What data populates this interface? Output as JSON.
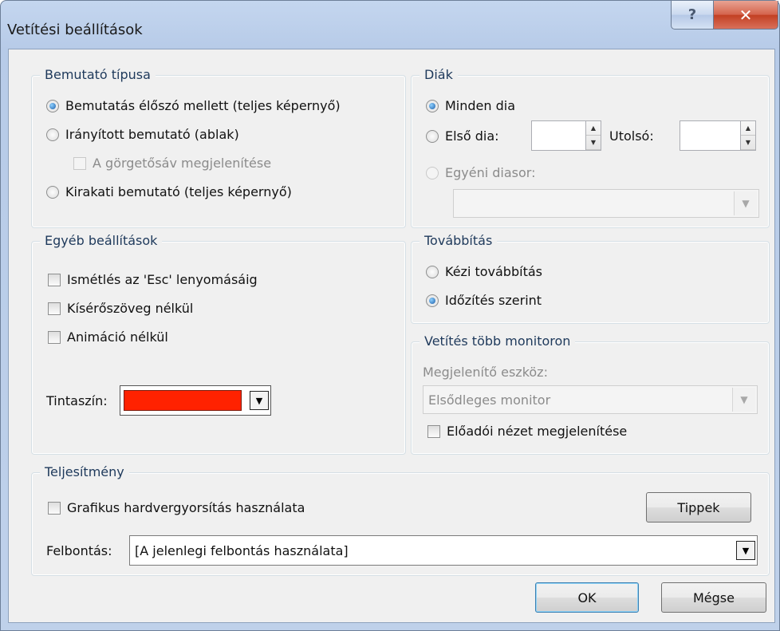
{
  "window": {
    "title": "Vetítési beállítások",
    "help_glyph": "?",
    "close_glyph": "✕"
  },
  "show_type": {
    "legend": "Bemutató típusa",
    "options": [
      {
        "label": "Bemutatás élőszó mellett (teljes képernyő)",
        "checked": true
      },
      {
        "label": "Irányított bemutató (ablak)",
        "checked": false
      },
      {
        "label": "Kirakati bemutató (teljes képernyő)",
        "checked": false
      }
    ],
    "scrollbar_label": "A görgetősáv megjelenítése"
  },
  "slides": {
    "legend": "Diák",
    "all_label": "Minden dia",
    "from_label": "Első dia:",
    "to_label": "Utolsó:",
    "from_value": "",
    "to_value": "",
    "custom_label": "Egyéni diasor:",
    "custom_value": ""
  },
  "other": {
    "legend": "Egyéb beállítások",
    "loop_label": "Ismétlés az 'Esc' lenyomásáig",
    "no_narration_label": "Kísérőszöveg nélkül",
    "no_animation_label": "Animáció nélkül",
    "pen_color_label": "Tintaszín:",
    "pen_color": "#ff2200"
  },
  "advance": {
    "legend": "Továbbítás",
    "manual_label": "Kézi továbbítás",
    "timings_label": "Időzítés szerint"
  },
  "monitors": {
    "legend": "Vetítés több monitoron",
    "display_label": "Megjelenítő eszköz:",
    "display_value": "Elsődleges monitor",
    "presenter_view_label": "Előadói nézet megjelenítése"
  },
  "performance": {
    "legend": "Teljesítmény",
    "hw_accel_label": "Grafikus hardvergyorsítás használata",
    "tips_button": "Tippek",
    "resolution_label": "Felbontás:",
    "resolution_value": "[A jelenlegi felbontás használata]"
  },
  "footer": {
    "ok": "OK",
    "cancel": "Mégse"
  },
  "colors": {
    "title_bar": "#b7cbe8",
    "client_bg": "#f0f0f0",
    "legend_text": "#1e395b",
    "close_button": "#c23f22"
  }
}
